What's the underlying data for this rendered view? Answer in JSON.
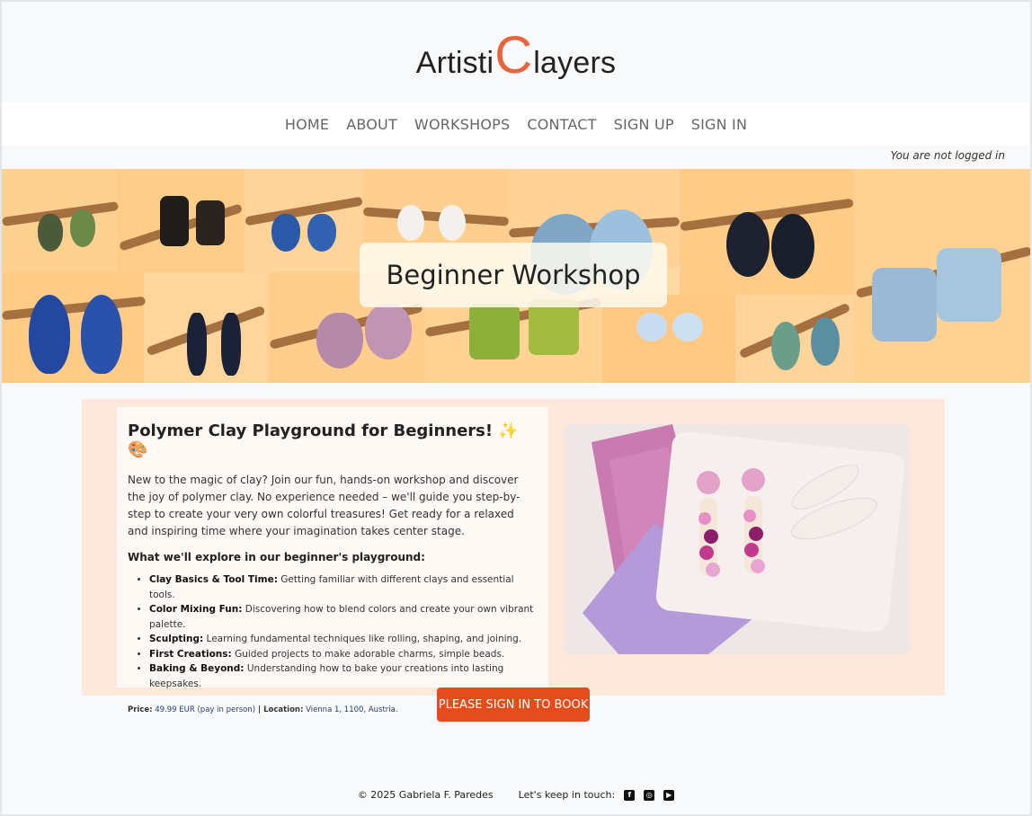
{
  "logo": {
    "part1": "Artisti",
    "big_c": "C",
    "part2": "layers"
  },
  "nav": [
    "HOME",
    "ABOUT",
    "WORKSHOPS",
    "CONTACT",
    "SIGN UP",
    "SIGN IN"
  ],
  "login_status": "You are not logged in",
  "hero": {
    "title": "Beginner Workshop"
  },
  "workshop": {
    "heading": "Polymer Clay Playground for Beginners! ✨ 🎨",
    "intro": "New to the magic of clay? Join our fun, hands-on workshop and discover the joy of polymer clay. No experience needed – we'll guide you step-by-step to create your very own colorful treasures! Get ready for a relaxed and inspiring time where your imagination takes center stage.",
    "explore_heading": "What we'll explore in our beginner's playground:",
    "items": [
      {
        "term": "Clay Basics & Tool Time:",
        "text": " Getting familiar with different clays and essential tools."
      },
      {
        "term": "Color Mixing Fun:",
        "text": " Discovering how to blend colors and create your own vibrant palette."
      },
      {
        "term": "Sculpting:",
        "text": " Learning fundamental techniques like rolling, shaping, and joining."
      },
      {
        "term": "First Creations:",
        "text": " Guided projects to make adorable charms, simple beads."
      },
      {
        "term": "Baking & Beyond:",
        "text": " Understanding how to bake your creations into lasting keepsakes."
      }
    ],
    "price_label": "Price:",
    "price_value": " 49.99 EUR (pay in person)",
    "location_label": " | Location:",
    "location_value": " Vienna 1, 1100, Austria."
  },
  "book_button": "PLEASE SIGN IN TO BOOK",
  "footer": {
    "copyright": "© 2025 Gabriela F. Paredes",
    "touch": "Let's keep in touch:",
    "icons": [
      "facebook-icon",
      "instagram-icon",
      "youtube-icon"
    ]
  },
  "colors": {
    "accent": "#e8643a",
    "button": "#e44d1b",
    "content_bg": "#fde8dc"
  }
}
